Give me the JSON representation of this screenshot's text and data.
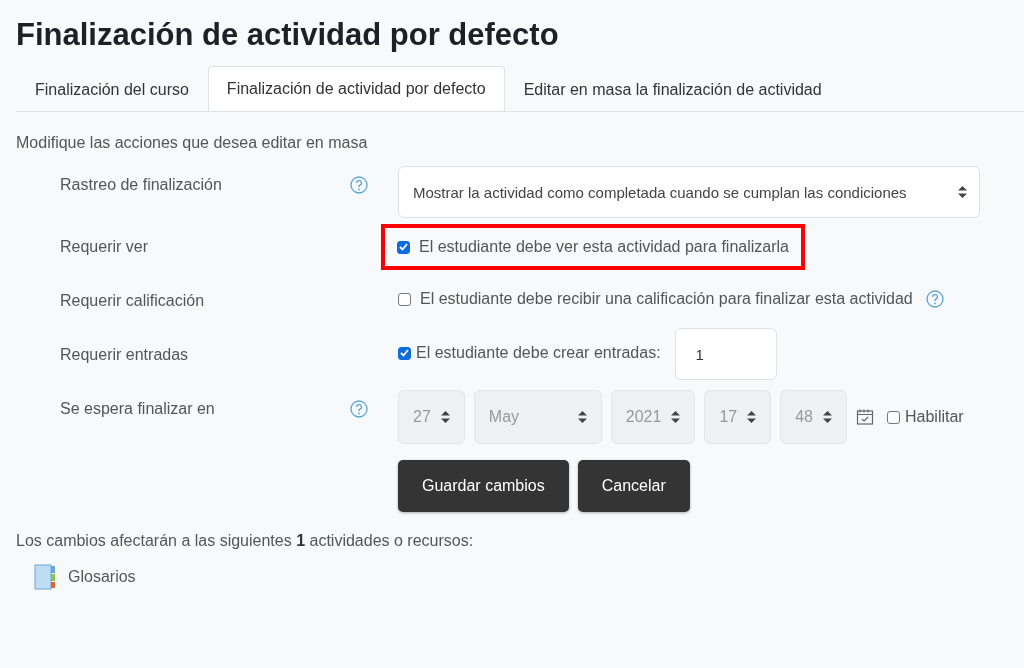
{
  "title": "Finalización de actividad por defecto",
  "tabs": [
    {
      "label": "Finalización del curso",
      "selected": false
    },
    {
      "label": "Finalización de actividad por defecto",
      "selected": true
    },
    {
      "label": "Editar en masa la finalización de actividad",
      "selected": false
    }
  ],
  "intro": "Modifique las acciones que desea editar en masa",
  "rows": [
    {
      "kind": "select",
      "label": "Rastreo de finalización",
      "help": true,
      "value": "Mostrar la actividad como completada cuando se cumplan las condiciones"
    },
    {
      "kind": "checkbox",
      "label": "Requerir ver",
      "help": false,
      "text": "El estudiante debe ver esta actividad para finalizarla",
      "checked": true,
      "highlighted": true,
      "text_help": false
    },
    {
      "kind": "checkbox",
      "label": "Requerir calificación",
      "help": false,
      "text": "El estudiante debe recibir una calificación para finalizar esta actividad",
      "checked": false,
      "highlighted": false,
      "text_help": true
    },
    {
      "kind": "number",
      "label": "Requerir entradas",
      "help": false,
      "text": "El estudiante debe crear entradas:",
      "checked": true,
      "value": "1"
    },
    {
      "kind": "date",
      "label": "Se espera finalizar en",
      "help": true,
      "parts": [
        "27",
        "May",
        "2021",
        "17",
        "48"
      ],
      "disabled": true,
      "enable_label": "Habilitar",
      "enabled": false
    }
  ],
  "buttons": [
    "Guardar cambios",
    "Cancelar"
  ],
  "summary": "Los cambios afectarán a las siguientes **1** actividades o recursos:",
  "activities": [
    {
      "name": "Glosarios"
    }
  ]
}
